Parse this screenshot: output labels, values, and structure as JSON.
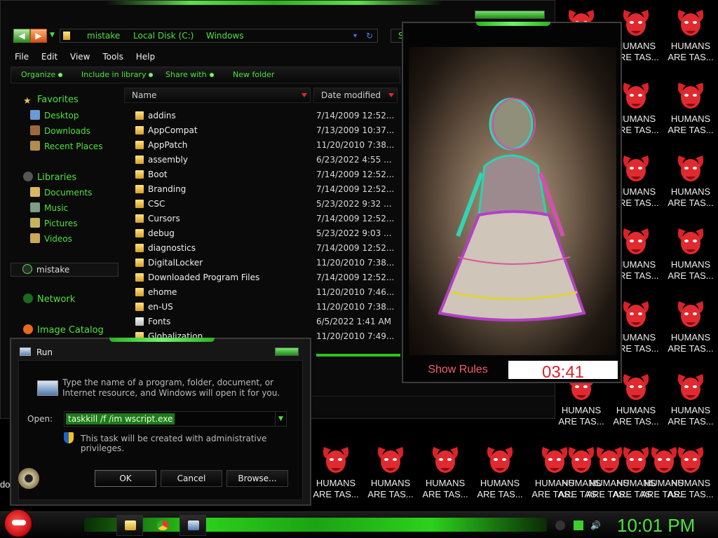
{
  "wallpaper": {
    "line1": "HUMANS",
    "line2": "ARE TAS...",
    "partial": "do"
  },
  "explorer": {
    "breadcrumb": [
      "mistake",
      "Local Disk (C:)",
      "Windows"
    ],
    "search_label": "Se",
    "menu": [
      "File",
      "Edit",
      "View",
      "Tools",
      "Help"
    ],
    "commands": [
      "Organize",
      "Include in library",
      "Share with",
      "New folder"
    ],
    "nav": {
      "favorites": "Favorites",
      "desktop": "Desktop",
      "downloads": "Downloads",
      "recent": "Recent Places",
      "libraries": "Libraries",
      "documents": "Documents",
      "music": "Music",
      "pictures": "Pictures",
      "videos": "Videos",
      "homegroup": "mistake",
      "network": "Network",
      "catalog": "Image Catalog"
    },
    "columns": {
      "name": "Name",
      "date": "Date modified"
    },
    "files": [
      {
        "name": "addins",
        "date": "7/14/2009 12:52..."
      },
      {
        "name": "AppCompat",
        "date": "7/13/2009 10:37..."
      },
      {
        "name": "AppPatch",
        "date": "11/20/2010 7:38..."
      },
      {
        "name": "assembly",
        "date": "6/23/2022 4:55 ..."
      },
      {
        "name": "Boot",
        "date": "7/14/2009 12:52..."
      },
      {
        "name": "Branding",
        "date": "7/14/2009 12:52..."
      },
      {
        "name": "CSC",
        "date": "5/23/2022 9:32 ..."
      },
      {
        "name": "Cursors",
        "date": "7/14/2009 12:52..."
      },
      {
        "name": "debug",
        "date": "5/23/2022 9:03 ..."
      },
      {
        "name": "diagnostics",
        "date": "7/14/2009 12:52..."
      },
      {
        "name": "DigitalLocker",
        "date": "11/20/2010 7:38..."
      },
      {
        "name": "Downloaded Program Files",
        "date": "7/14/2009 12:52..."
      },
      {
        "name": "ehome",
        "date": "11/20/2010 7:46..."
      },
      {
        "name": "en-US",
        "date": "11/20/2010 7:38..."
      },
      {
        "name": "Fonts",
        "date": "6/5/2022 1:41 AM"
      },
      {
        "name": "Globalization",
        "date": "11/20/2010 7:49..."
      }
    ]
  },
  "viewer": {
    "show_rules": "Show Rules",
    "timer": "03:41"
  },
  "run": {
    "title": "Run",
    "description": "Type the name of a program, folder, document, or Internet resource, and Windows will open it for you.",
    "open_label": "Open:",
    "command": "taskkill /f /im wscript.exe",
    "admin_note": "This task will be created with administrative privileges.",
    "ok": "OK",
    "cancel": "Cancel",
    "browse": "Browse..."
  },
  "taskbar": {
    "clock": "10:01 PM"
  },
  "colors": {
    "accent_green": "#4ee23c",
    "timer_red": "#d9222a",
    "rules_red": "#f2616a"
  }
}
